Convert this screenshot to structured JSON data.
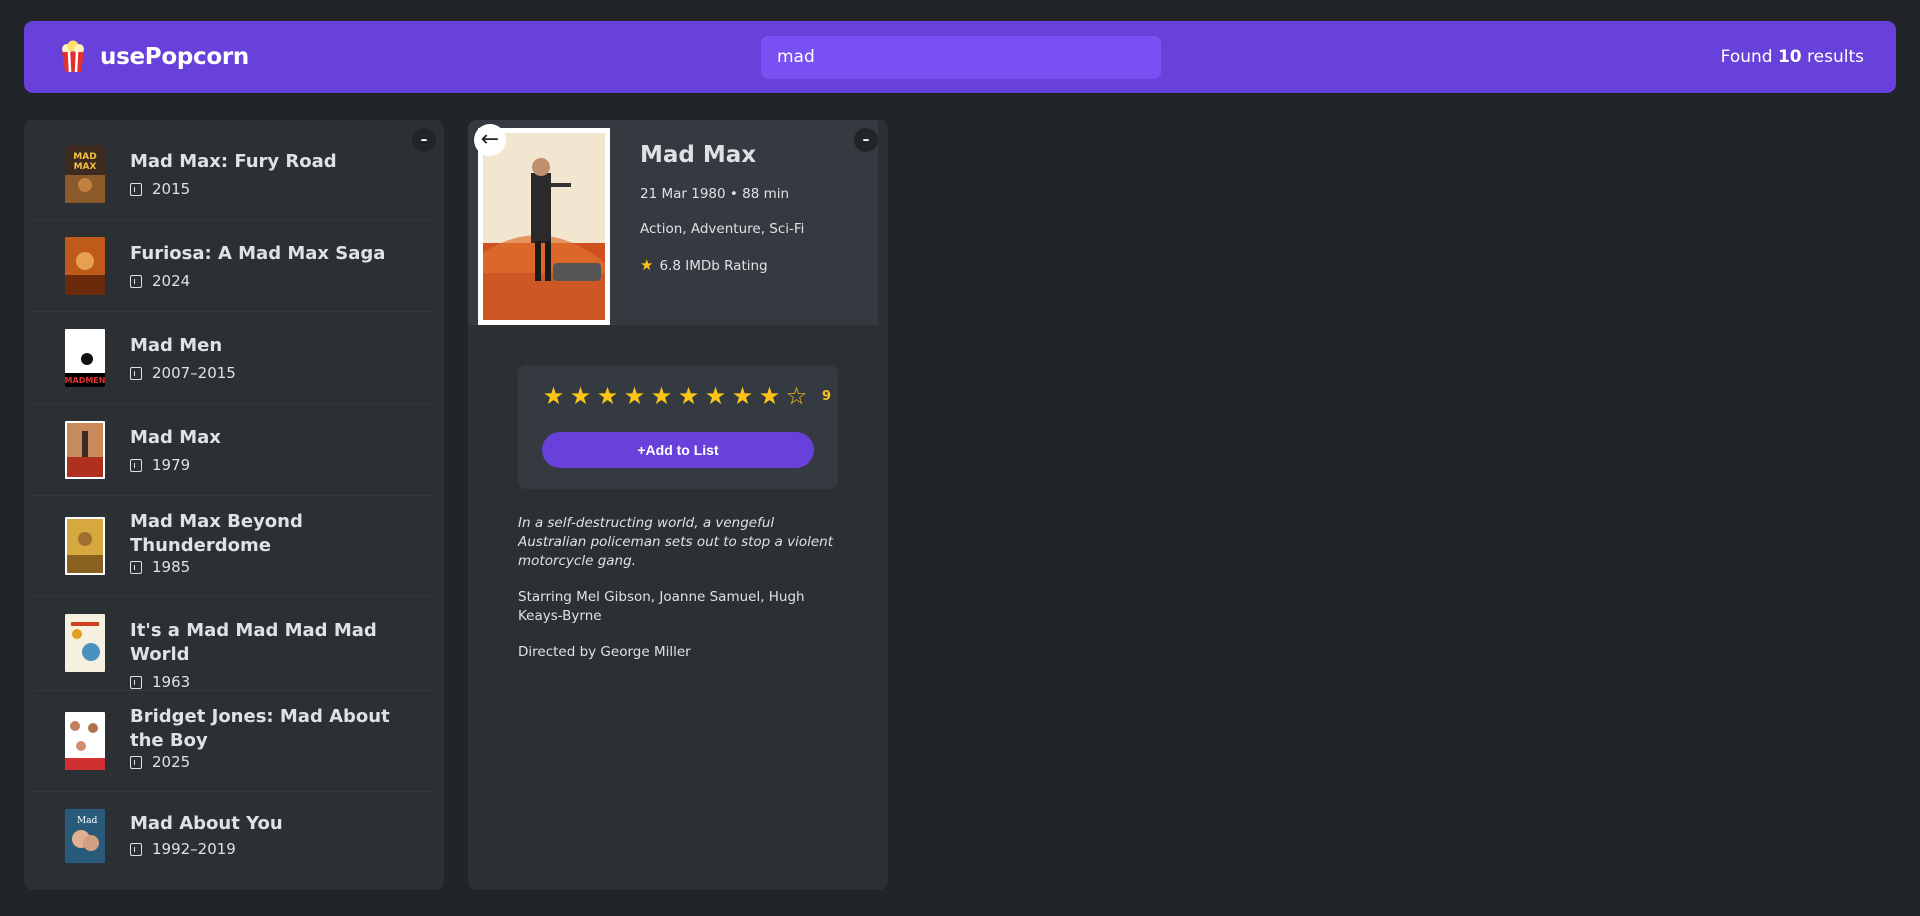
{
  "app": {
    "name": "usePopcorn"
  },
  "search": {
    "value": "mad"
  },
  "results": {
    "prefix": "Found",
    "count": "10",
    "suffix": "results"
  },
  "toggle_label": "–",
  "movies": [
    {
      "title": "Mad Max: Fury Road",
      "year": "2015"
    },
    {
      "title": "Furiosa: A Mad Max Saga",
      "year": "2024"
    },
    {
      "title": "Mad Men",
      "year": "2007–2015"
    },
    {
      "title": "Mad Max",
      "year": "1979"
    },
    {
      "title": "Mad Max Beyond Thunderdome",
      "year": "1985"
    },
    {
      "title": "It's a Mad Mad Mad Mad World",
      "year": "1963"
    },
    {
      "title": "Bridget Jones: Mad About the Boy",
      "year": "2025"
    },
    {
      "title": "Mad About You",
      "year": "1992–2019"
    }
  ],
  "details": {
    "back_label": "←",
    "title": "Mad Max",
    "released_runtime": "21 Mar 1980 • 88 min",
    "genres": "Action, Adventure, Sci-Fi",
    "imdb_rating": "6.8 IMDb Rating",
    "user_rating": 9,
    "max_rating": 10,
    "user_rating_label": "9",
    "add_button": "+Add to List",
    "plot": "In a self-destructing world, a vengeful Australian policeman sets out to stop a violent motorcycle gang.",
    "starring": "Starring Mel Gibson, Joanne Samuel, Hugh Keays-Byrne",
    "director": "Directed by George Miller"
  },
  "colors": {
    "background": "#212529",
    "nav": "#6741d9",
    "accent": "#7950f2",
    "box": "#2b3035",
    "star": "#fcc419"
  }
}
